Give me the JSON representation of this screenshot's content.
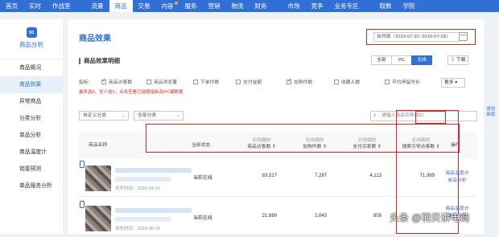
{
  "topnav": {
    "items": [
      "首页",
      "实时",
      "作战室",
      "流量",
      "商品",
      "交易",
      "内容",
      "服务",
      "营销",
      "物流",
      "财务",
      "市场",
      "竞争",
      "业务专区",
      "取数",
      "学院"
    ],
    "active_index": 4
  },
  "sidebar": {
    "title": "商品分析",
    "items": [
      "商品概况",
      "商品效果",
      "异常商品",
      "分类分析",
      "单品分析",
      "商品温度计",
      "销量预测",
      "单品服务分析"
    ],
    "active_index": 1
  },
  "side_tool": {
    "label": "体验新版"
  },
  "page": {
    "title": "商品效果"
  },
  "date": {
    "label": "自然周（2019-07-22~2019-07-28）"
  },
  "section": {
    "title": "商品效果明细"
  },
  "tabs": {
    "items": [
      "全部",
      "PC",
      "无线"
    ],
    "active_index": 2
  },
  "download": {
    "label": "下载"
  },
  "metrics": {
    "label": "指标：",
    "items": [
      {
        "label": "商品访客数",
        "checked": true
      },
      {
        "label": "商品浏览量",
        "checked": false
      },
      {
        "label": "下单件数",
        "checked": false
      },
      {
        "label": "支付金额",
        "checked": false
      },
      {
        "label": "加购件数",
        "checked": true
      },
      {
        "label": "收藏人数",
        "checked": false
      },
      {
        "label": "平均停留时长",
        "checked": false
      }
    ],
    "more": "更多"
  },
  "hint": "最多选5，至少选1，点击查看已选择指标及PC端数据",
  "filters": {
    "category": "自定义分类",
    "all": "全部分类",
    "search_placeholder": "请输入商品名称或ID"
  },
  "table": {
    "headers": {
      "name": "商品名称",
      "status": "当前状态",
      "col1_sub": "无线端的",
      "col1": "商品访客数",
      "col2_sub": "无线端的",
      "col2": "加购件数",
      "col3_sub": "无线端的",
      "col3": "支付买家数",
      "col4_sub": "无线端的",
      "col4": "搜索引导访客数",
      "op": "操作"
    },
    "rows": [
      {
        "published": "发布时间：2019-04-02",
        "status": "当前在线",
        "v1": "83,517",
        "v2": "7,287",
        "v3": "4,113",
        "v4": "71,989",
        "op1": "商品温度计",
        "op2": "单品分析"
      },
      {
        "published": "发布时间：2019-08-14",
        "status": "当前在线",
        "v1": "21,889",
        "v2": "2,643",
        "v3": "809",
        "v4": "",
        "op1": "商品温度计",
        "op2": "单品分析"
      }
    ]
  },
  "watermark": "头条 @羽贝讲电商",
  "colors": {
    "primary": "#2f6fd6",
    "highlight": "#e02424"
  }
}
